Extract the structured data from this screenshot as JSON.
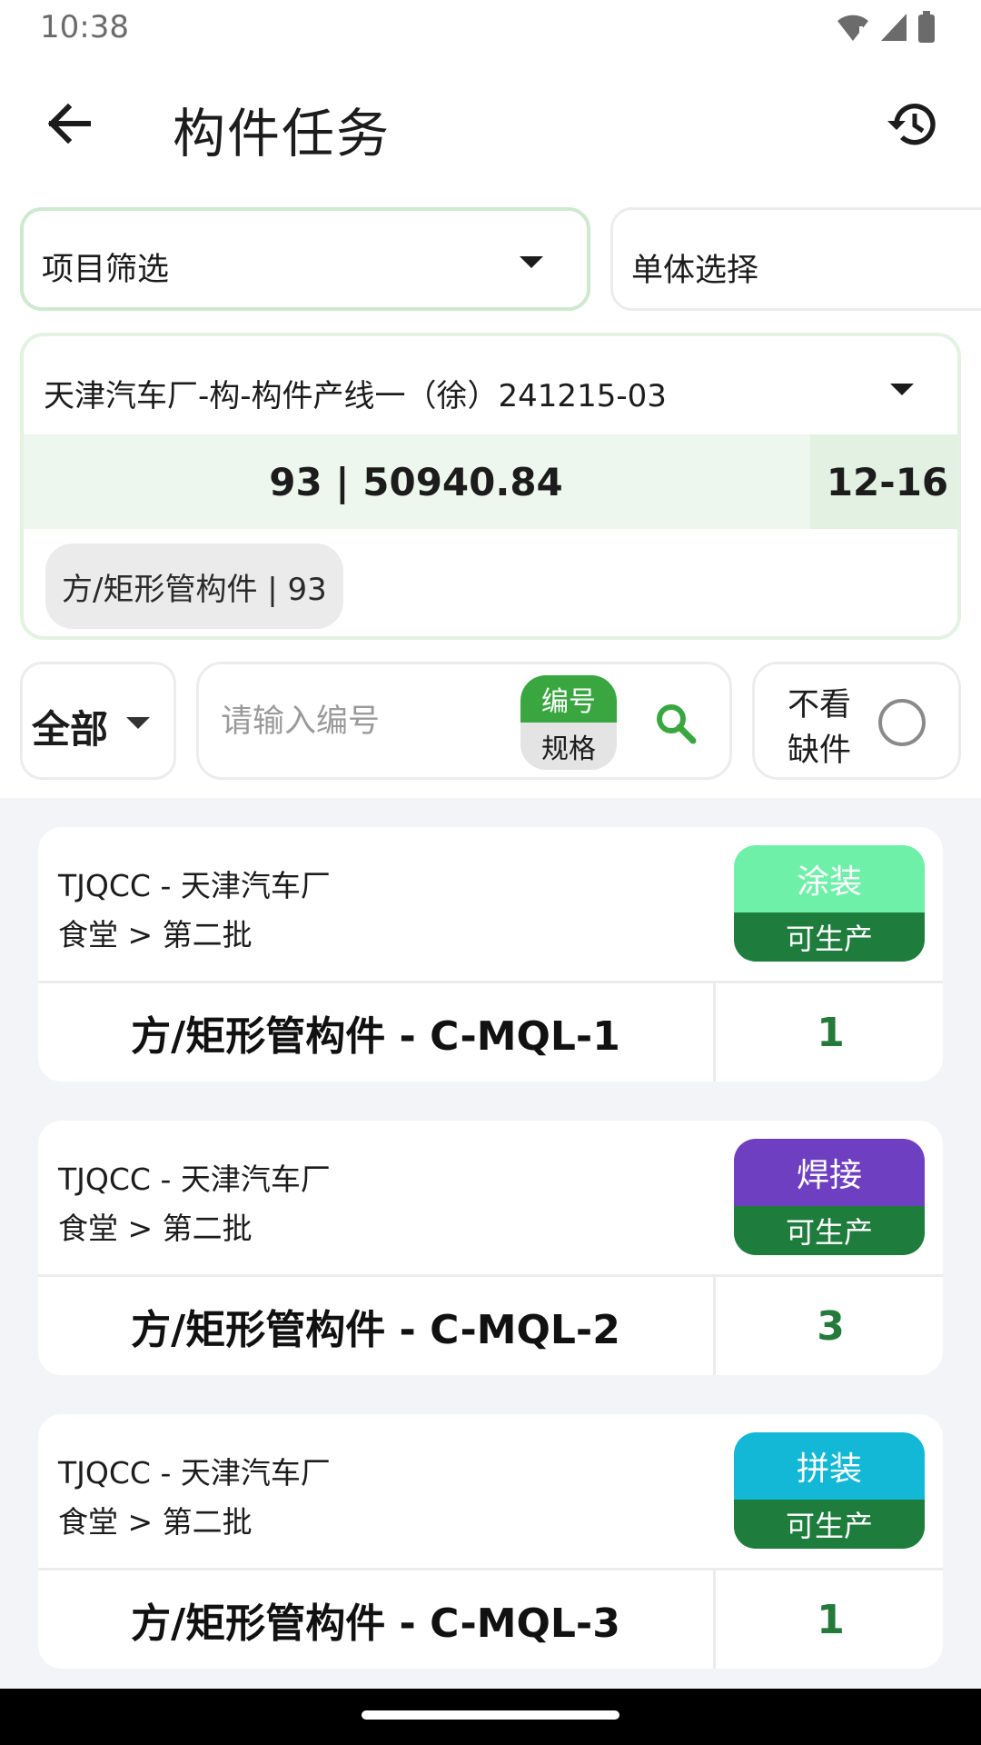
{
  "status_bar": {
    "time": "10:38"
  },
  "app_bar": {
    "title": "构件任务"
  },
  "filters": {
    "project_label": "项目筛选",
    "unit_label": "单体选择"
  },
  "task": {
    "name": "天津汽车厂-构-构件产线一（徐）241215-03",
    "summary": "93 | 50940.84",
    "date": "12-16",
    "chip": "方/矩形管构件 | 93"
  },
  "search": {
    "scope": "全部",
    "placeholder": "请输入编号",
    "mode_selected": "编号",
    "mode_other": "规格",
    "missing_label": "不看缺件"
  },
  "items": [
    {
      "line1": "TJQCC - 天津汽车厂",
      "line2": "食堂 > 第二批",
      "process": "涂装",
      "process_color": "#6ef0a8",
      "status": "可生产",
      "name": "方/矩形管构件 - C-MQL-1",
      "qty": "1"
    },
    {
      "line1": "TJQCC - 天津汽车厂",
      "line2": "食堂 > 第二批",
      "process": "焊接",
      "process_color": "#6f3fc2",
      "status": "可生产",
      "name": "方/矩形管构件 - C-MQL-2",
      "qty": "3"
    },
    {
      "line1": "TJQCC - 天津汽车厂",
      "line2": "食堂 > 第二批",
      "process": "拼装",
      "process_color": "#12b8d6",
      "status": "可生产",
      "name": "方/矩形管构件 - C-MQL-3",
      "qty": "1"
    }
  ],
  "icons": {
    "back": "arrow-left-icon",
    "history": "history-icon",
    "search": "search-icon",
    "dropdown": "caret-down-icon"
  },
  "colors": {
    "accent_green": "#3aa640",
    "status_green": "#1e7d3c",
    "qty_green": "#237a3b"
  }
}
